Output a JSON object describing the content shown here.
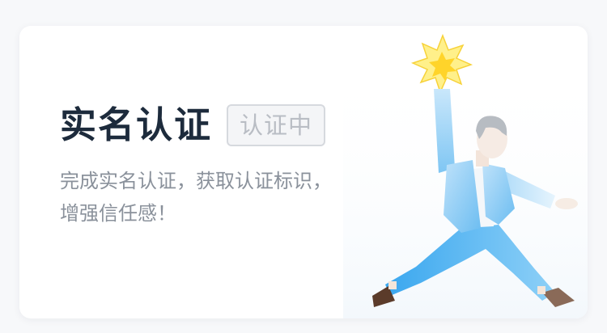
{
  "card": {
    "title": "实名认证",
    "status_badge": "认证中",
    "description_line1": "完成实名认证，获取认证标识，",
    "description_line2": "增强信任感！"
  },
  "colors": {
    "title": "#1d2b3c",
    "badge_text": "#b9bdc4",
    "badge_border": "#d6d9de",
    "description": "#8a919b",
    "figure_blue": "#4db0ef",
    "star_yellow": "#ffe24a"
  },
  "icons": {
    "illustration": "person-holding-star-illustration"
  }
}
